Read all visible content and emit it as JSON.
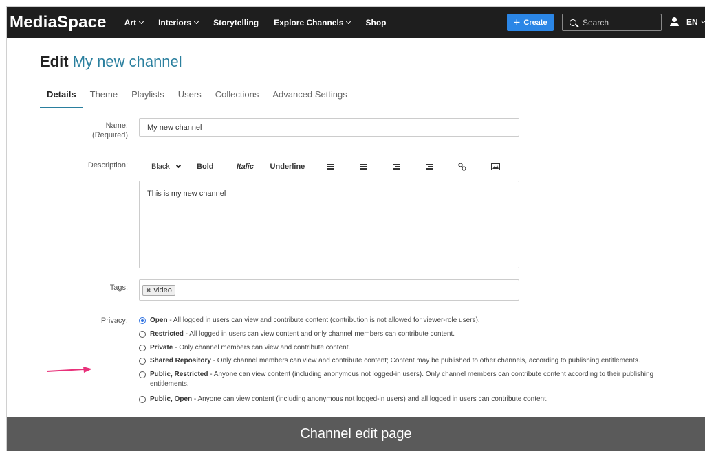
{
  "app": {
    "logo": "MediaSpace"
  },
  "nav": {
    "items": [
      {
        "label": "Art",
        "dropdown": true
      },
      {
        "label": "Interiors",
        "dropdown": true
      },
      {
        "label": "Storytelling",
        "dropdown": false
      },
      {
        "label": "Explore Channels",
        "dropdown": true
      },
      {
        "label": "Shop",
        "dropdown": false
      }
    ],
    "create_label": "Create",
    "search_placeholder": "Search",
    "language": "EN"
  },
  "page": {
    "title_prefix": "Edit",
    "channel_name": "My new channel",
    "tabs": [
      "Details",
      "Theme",
      "Playlists",
      "Users",
      "Collections",
      "Advanced Settings"
    ],
    "active_tab": "Details"
  },
  "form": {
    "name_label": "Name:",
    "name_required": "(Required)",
    "name_value": "My new channel",
    "description_label": "Description:",
    "toolbar": {
      "color": "Black",
      "bold": "Bold",
      "italic": "Italic",
      "underline": "Underline",
      "icons": [
        "bulleted-list-icon",
        "numbered-list-icon",
        "outdent-icon",
        "indent-icon",
        "link-icon",
        "image-icon"
      ]
    },
    "description_value": "This is my new channel",
    "tags_label": "Tags:",
    "tags": [
      "video"
    ],
    "privacy_label": "Privacy:",
    "privacy_options": [
      {
        "title": "Open",
        "desc": " - All logged in users can view and contribute content (contribution is not allowed for viewer-role users).",
        "selected": true
      },
      {
        "title": "Restricted",
        "desc": " - All logged in users can view content and only channel members can contribute content.",
        "selected": false
      },
      {
        "title": "Private",
        "desc": " - Only channel members can view and contribute content.",
        "selected": false
      },
      {
        "title": "Shared Repository",
        "desc": " - Only channel members can view and contribute content; Content may be published to other channels, according to publishing entitlements.",
        "selected": false
      },
      {
        "title": "Public, Restricted",
        "desc": " - Anyone can view content (including anonymous not logged-in users). Only channel members can contribute content according to their publishing entitlements.",
        "selected": false
      },
      {
        "title": "Public, Open",
        "desc": " - Anyone can view content (including anonymous not logged-in users) and all logged in users can contribute content.",
        "selected": false
      }
    ]
  },
  "caption": "Channel edit page",
  "colors": {
    "accent": "#2a7f9e",
    "create": "#2b86e6",
    "arrow": "#e8317a",
    "radio": "#2b6fe0"
  }
}
